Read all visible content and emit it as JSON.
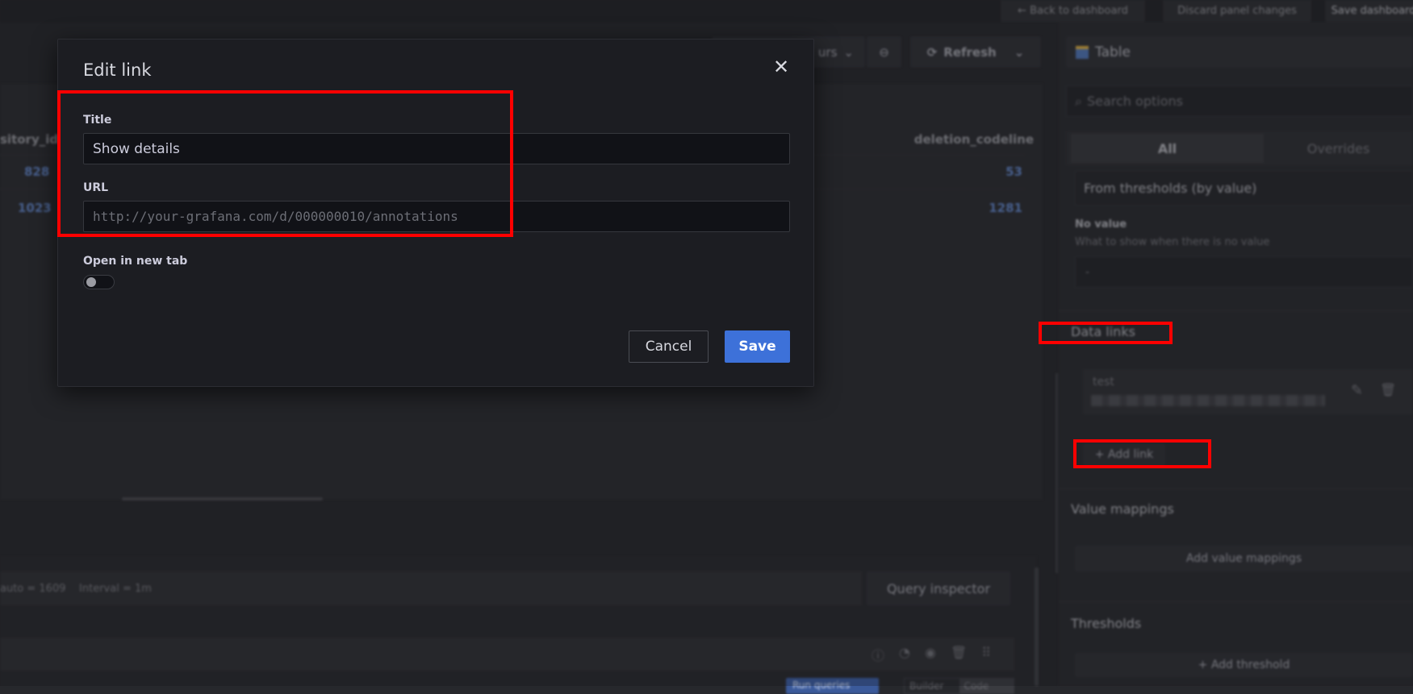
{
  "topbar": {
    "back": "← Back to dashboard",
    "discard": "Discard panel changes",
    "save": "Save dashboard"
  },
  "toolbar": {
    "time_range": "urs",
    "refresh": "Refresh"
  },
  "table": {
    "columns": [
      "sitory_id",
      "deletion_codeline"
    ],
    "rows": [
      [
        "828",
        "53"
      ],
      [
        "1023",
        "1281"
      ]
    ]
  },
  "query": {
    "info": "auto = 1609    Interval = 1m",
    "inspector": "Query inspector",
    "run_button": "Run queries",
    "builder": "Builder",
    "code": "Code"
  },
  "options": {
    "visualization": "Table",
    "search_placeholder": "Search options",
    "tabs": [
      "All",
      "Overrides"
    ],
    "color_scheme": "From thresholds (by value)",
    "no_value_label": "No value",
    "no_value_desc": "What to show when there is no value",
    "no_value_input": "-",
    "data_links_title": "Data links",
    "link_title": "test",
    "add_link": "+ Add link",
    "value_mappings_title": "Value mappings",
    "add_value_mappings": "Add value mappings",
    "thresholds_title": "Thresholds",
    "add_threshold": "+ Add threshold"
  },
  "modal": {
    "title": "Edit link",
    "title_label": "Title",
    "title_value": "Show details",
    "url_label": "URL",
    "url_placeholder": "http://your-grafana.com/d/000000010/annotations",
    "new_tab_label": "Open in new tab",
    "new_tab_enabled": false,
    "cancel": "Cancel",
    "save": "Save"
  },
  "colors": {
    "accent": "#3d71d9",
    "highlight": "#ff0000"
  }
}
